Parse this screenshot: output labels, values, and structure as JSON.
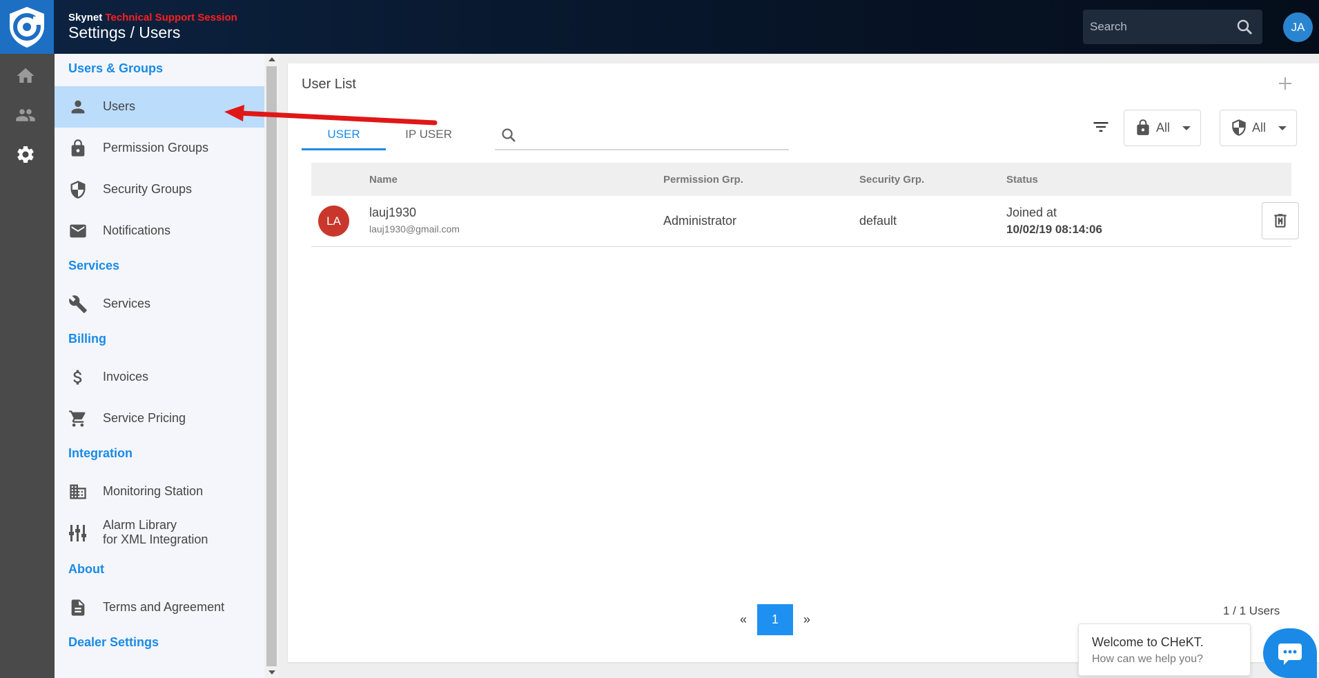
{
  "header": {
    "brand": "Skynet",
    "session_label": "Technical Support Session",
    "title": "Settings / Users",
    "search_placeholder": "Search",
    "user_initials": "JA"
  },
  "rail": {
    "items": [
      {
        "icon": "home-icon"
      },
      {
        "icon": "people-icon"
      },
      {
        "icon": "gear-icon",
        "active": true
      }
    ]
  },
  "sidebar": {
    "sections": [
      {
        "heading": "Users & Groups",
        "items": [
          {
            "label": "Users",
            "icon": "person-icon",
            "active": true
          },
          {
            "label": "Permission Groups",
            "icon": "lock-icon"
          },
          {
            "label": "Security Groups",
            "icon": "shield-icon"
          },
          {
            "label": "Notifications",
            "icon": "mail-icon"
          }
        ]
      },
      {
        "heading": "Services",
        "items": [
          {
            "label": "Services",
            "icon": "wrench-icon"
          }
        ]
      },
      {
        "heading": "Billing",
        "items": [
          {
            "label": "Invoices",
            "icon": "dollar-icon"
          },
          {
            "label": "Service Pricing",
            "icon": "cart-icon"
          }
        ]
      },
      {
        "heading": "Integration",
        "items": [
          {
            "label": "Monitoring Station",
            "icon": "building-icon"
          },
          {
            "label": "Alarm Library",
            "label2": "for XML Integration",
            "icon": "sliders-icon"
          }
        ]
      },
      {
        "heading": "About",
        "items": [
          {
            "label": "Terms and Agreement",
            "icon": "document-icon"
          }
        ]
      },
      {
        "heading": "Dealer Settings",
        "items": []
      }
    ]
  },
  "main": {
    "title": "User List",
    "tabs": [
      {
        "label": "USER",
        "active": true
      },
      {
        "label": "IP USER",
        "active": false
      }
    ],
    "filters": [
      {
        "icon": "lock-icon",
        "value": "All"
      },
      {
        "icon": "shield-icon",
        "value": "All"
      }
    ],
    "table": {
      "columns": [
        "Name",
        "Permission Grp.",
        "Security Grp.",
        "Status"
      ],
      "rows": [
        {
          "initials": "LA",
          "name": "lauj1930",
          "email": "lauj1930@gmail.com",
          "permission_group": "Administrator",
          "security_group": "default",
          "status_label": "Joined at",
          "status_time": "10/02/19 08:14:06"
        }
      ]
    },
    "pagination": {
      "prev": "«",
      "current": "1",
      "next": "»"
    },
    "count_text": "1 / 1 Users"
  },
  "chat": {
    "greeting": "Welcome to CHeKT.",
    "prompt": "How can we help you?"
  },
  "colors": {
    "accent": "#1a8ae6",
    "session_red": "#ff1e1e",
    "avatar_red": "#c9372c",
    "active_nav": "#bbdcfb"
  }
}
